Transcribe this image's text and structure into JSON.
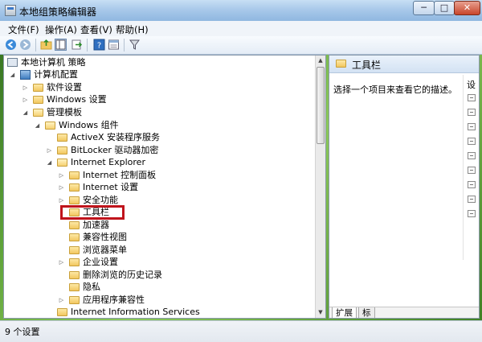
{
  "window": {
    "title": "本地组策略编辑器",
    "controls": {
      "minimize": "─",
      "maximize": "□",
      "close": "✕"
    }
  },
  "menubar": [
    {
      "label": "文件(F)"
    },
    {
      "label": "操作(A)"
    },
    {
      "label": "查看(V)"
    },
    {
      "label": "帮助(H)"
    }
  ],
  "toolbar": {
    "icons": [
      "back-arrow-icon",
      "forward-arrow-icon",
      "folder-up-icon",
      "show-hide-tree-icon",
      "export-list-icon",
      "help-icon",
      "properties-icon",
      "filter-icon"
    ]
  },
  "tree": {
    "items": [
      {
        "label": "本地计算机 策略",
        "icon": "computer-policy-icon"
      },
      {
        "label": "计算机配置",
        "icon": "computer-config-icon",
        "expander": "◢"
      },
      {
        "label": "软件设置",
        "icon": "folder-icon",
        "expander": "▷"
      },
      {
        "label": "Windows 设置",
        "icon": "folder-icon",
        "expander": "▷"
      },
      {
        "label": "管理模板",
        "icon": "folder-open-icon",
        "expander": "◢"
      },
      {
        "label": "Windows 组件",
        "icon": "folder-open-icon",
        "expander": "◢"
      },
      {
        "label": "ActiveX 安装程序服务",
        "icon": "folder-icon",
        "expander": ""
      },
      {
        "label": "BitLocker 驱动器加密",
        "icon": "folder-icon",
        "expander": "▷"
      },
      {
        "label": "Internet Explorer",
        "icon": "folder-open-icon",
        "expander": "◢"
      },
      {
        "label": "Internet 控制面板",
        "icon": "folder-icon",
        "expander": "▷"
      },
      {
        "label": "Internet 设置",
        "icon": "folder-icon",
        "expander": "▷"
      },
      {
        "label": "安全功能",
        "icon": "folder-icon",
        "expander": "▷"
      },
      {
        "label": "工具栏",
        "icon": "folder-icon",
        "expander": "",
        "selected": true
      },
      {
        "label": "加速器",
        "icon": "folder-icon",
        "expander": ""
      },
      {
        "label": "兼容性视图",
        "icon": "folder-icon",
        "expander": ""
      },
      {
        "label": "浏览器菜单",
        "icon": "folder-icon",
        "expander": ""
      },
      {
        "label": "企业设置",
        "icon": "folder-icon",
        "expander": "▷"
      },
      {
        "label": "删除浏览的历史记录",
        "icon": "folder-icon",
        "expander": ""
      },
      {
        "label": "隐私",
        "icon": "folder-icon",
        "expander": ""
      },
      {
        "label": "应用程序兼容性",
        "icon": "folder-icon",
        "expander": "▷"
      },
      {
        "label": "Internet Information Services",
        "icon": "folder-icon",
        "expander": ""
      }
    ],
    "scrollbar": {
      "up": "▲",
      "down": "▼"
    }
  },
  "details": {
    "title": "工具栏",
    "description": "选择一个项目来查看它的描述。",
    "settings_column_header": "设",
    "setting_icons_count": 9,
    "tabs": [
      {
        "label": "扩展"
      },
      {
        "label": "标"
      }
    ]
  },
  "statusbar": {
    "text": "9 个设置"
  },
  "colors": {
    "highlight_box": "#c0141c",
    "desktop": "#5fa33a"
  }
}
